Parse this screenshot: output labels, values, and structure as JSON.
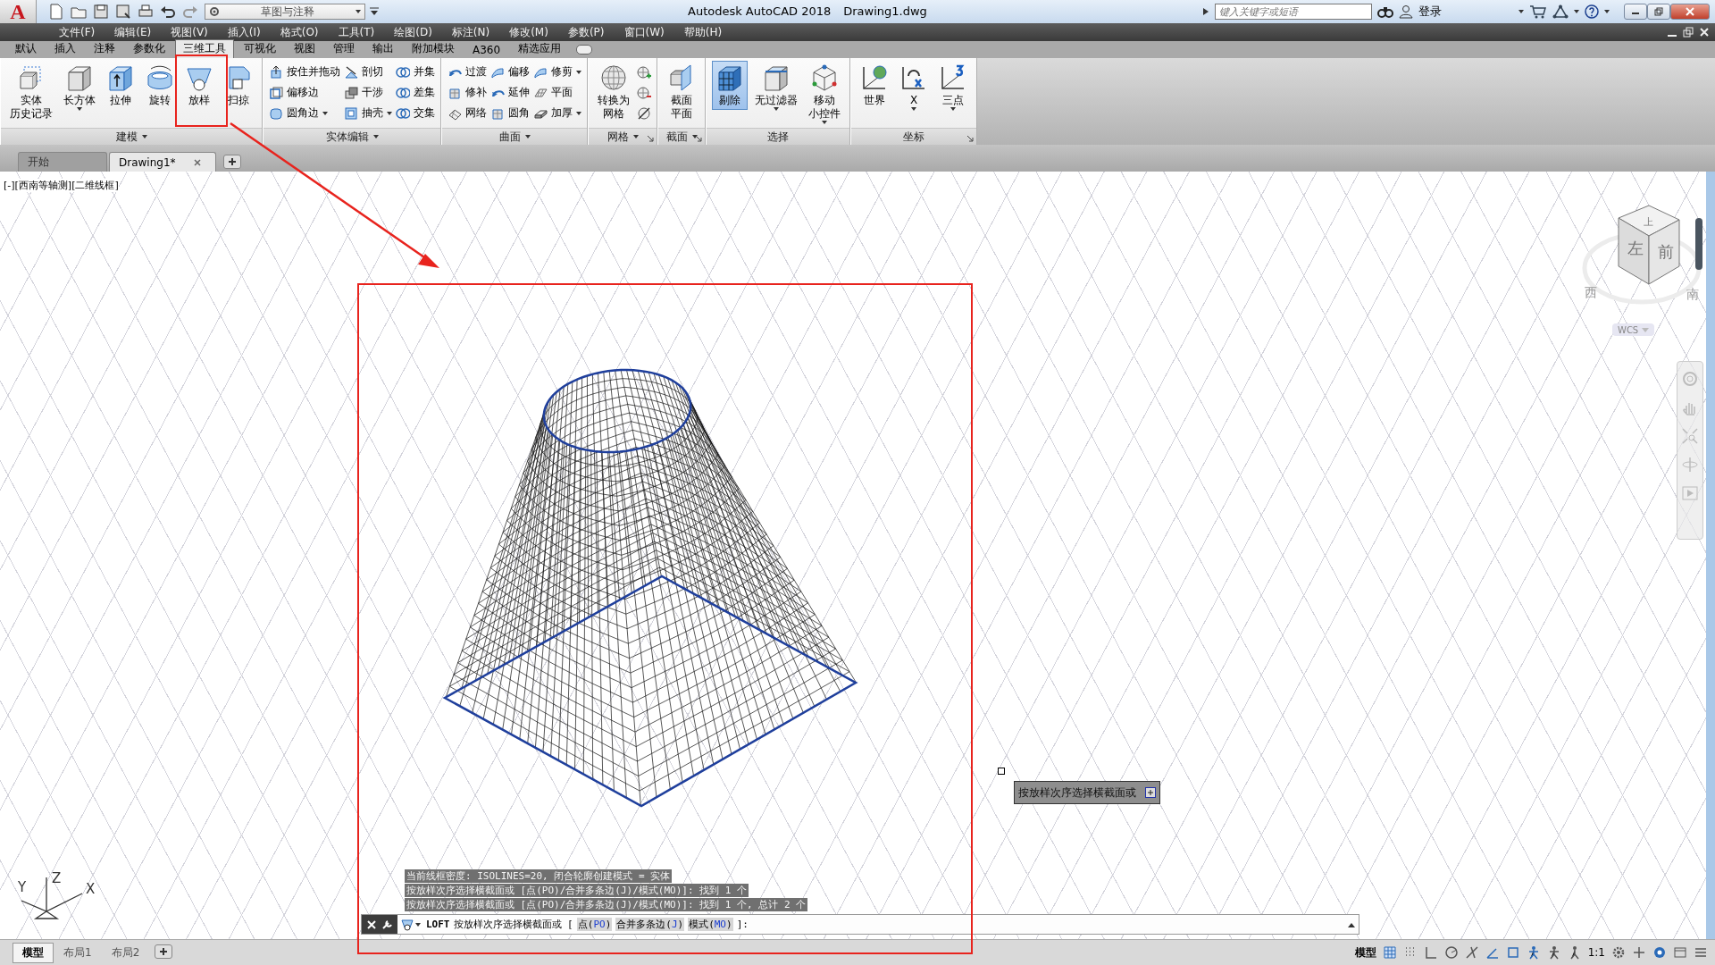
{
  "title_bar": {
    "logo": "A",
    "workspace": "草图与注释",
    "app_title": "Autodesk AutoCAD 2018",
    "document": "Drawing1.dwg",
    "search": {
      "placeholder": "键入关键字或短语"
    },
    "sign_in": "登录"
  },
  "menu_bar": [
    "文件(F)",
    "编辑(E)",
    "视图(V)",
    "插入(I)",
    "格式(O)",
    "工具(T)",
    "绘图(D)",
    "标注(N)",
    "修改(M)",
    "参数(P)",
    "窗口(W)",
    "帮助(H)"
  ],
  "ribbon_tabs": [
    {
      "label": "默认",
      "selected": false
    },
    {
      "label": "插入",
      "selected": false
    },
    {
      "label": "注释",
      "selected": false
    },
    {
      "label": "参数化",
      "selected": false
    },
    {
      "label": "三维工具",
      "selected": true
    },
    {
      "label": "可视化",
      "selected": false
    },
    {
      "label": "视图",
      "selected": false
    },
    {
      "label": "管理",
      "selected": false
    },
    {
      "label": "输出",
      "selected": false
    },
    {
      "label": "附加模块",
      "selected": false
    },
    {
      "label": "A360",
      "selected": false
    },
    {
      "label": "精选应用",
      "selected": false
    }
  ],
  "ribbon_panels": [
    {
      "title": "建模",
      "title_menu": true,
      "launcher": false,
      "columns": [
        {
          "kind": "large",
          "lines": [
            "实体",
            "历史记录"
          ],
          "dropdown": false,
          "active": false
        },
        {
          "kind": "large",
          "lines": [
            "长方体"
          ],
          "dropdown": true,
          "active": false
        },
        {
          "kind": "large",
          "lines": [
            "拉伸"
          ],
          "dropdown": false,
          "active": false
        },
        {
          "kind": "large",
          "lines": [
            "旋转"
          ],
          "dropdown": false,
          "active": false
        },
        {
          "kind": "large",
          "lines": [
            "放样"
          ],
          "dropdown": false,
          "active": false
        },
        {
          "kind": "large",
          "lines": [
            "扫掠"
          ],
          "dropdown": false,
          "active": false
        }
      ]
    },
    {
      "title": "实体编辑",
      "title_menu": true,
      "launcher": false,
      "columns": [
        {
          "kind": "stack",
          "items": [
            {
              "label": "按住并拖动",
              "dropdown": false
            },
            {
              "label": "偏移边",
              "dropdown": false
            },
            {
              "label": "圆角边",
              "dropdown": true
            }
          ]
        },
        {
          "kind": "stack",
          "items": [
            {
              "label": "剖切",
              "dropdown": false
            },
            {
              "label": "干涉",
              "dropdown": false
            },
            {
              "label": "抽壳",
              "dropdown": true
            }
          ]
        },
        {
          "kind": "stack",
          "items": [
            {
              "label": "并集",
              "dropdown": false
            },
            {
              "label": "差集",
              "dropdown": false
            },
            {
              "label": "交集",
              "dropdown": false
            }
          ]
        }
      ]
    },
    {
      "title": "曲面",
      "title_menu": true,
      "launcher": false,
      "columns": [
        {
          "kind": "stack",
          "items": [
            {
              "label": "过渡",
              "dropdown": false
            },
            {
              "label": "修补",
              "dropdown": false
            },
            {
              "label": "网络",
              "dropdown": false
            }
          ]
        },
        {
          "kind": "stack",
          "items": [
            {
              "label": "偏移",
              "dropdown": false
            },
            {
              "label": "延伸",
              "dropdown": false
            },
            {
              "label": "圆角",
              "dropdown": false
            }
          ]
        },
        {
          "kind": "stack",
          "items": [
            {
              "label": "修剪",
              "dropdown": true
            },
            {
              "label": "平面",
              "dropdown": false
            },
            {
              "label": "加厚",
              "dropdown": true
            }
          ]
        }
      ]
    },
    {
      "title": "网格",
      "title_menu": true,
      "launcher": true,
      "columns": [
        {
          "kind": "large",
          "lines": [
            "转换为",
            "网格"
          ],
          "dropdown": false,
          "active": false
        },
        {
          "kind": "stack",
          "items": [
            {
              "dropdown": false
            },
            {
              "dropdown": false
            },
            {
              "dropdown": false
            }
          ]
        }
      ]
    },
    {
      "title": "截面",
      "title_menu": true,
      "launcher": true,
      "columns": [
        {
          "kind": "large",
          "lines": [
            "截面",
            "平面"
          ],
          "dropdown": false,
          "active": false
        }
      ]
    },
    {
      "title": "选择",
      "title_menu": false,
      "launcher": false,
      "columns": [
        {
          "kind": "large",
          "lines": [
            "剔除"
          ],
          "dropdown": false,
          "active": true
        },
        {
          "kind": "large",
          "lines": [
            "无过滤器"
          ],
          "dropdown": true,
          "active": false
        },
        {
          "kind": "large",
          "lines": [
            "移动",
            "小控件"
          ],
          "dropdown": true,
          "active": false
        }
      ]
    },
    {
      "title": "坐标",
      "title_menu": false,
      "launcher": true,
      "columns": [
        {
          "kind": "large",
          "lines": [
            "世界"
          ],
          "dropdown": false,
          "active": false
        },
        {
          "kind": "large",
          "lines": [
            "X"
          ],
          "dropdown": true,
          "active": false
        },
        {
          "kind": "large",
          "lines": [
            "三点"
          ],
          "dropdown": true,
          "active": false
        }
      ]
    }
  ],
  "file_tabs": [
    {
      "label": "开始",
      "selected": false,
      "closable": false
    },
    {
      "label": "Drawing1*",
      "selected": true,
      "closable": true
    }
  ],
  "viewport": {
    "label": "[-][西南等轴测][二维线框]"
  },
  "view_cube": {
    "faces": [
      "上",
      "左",
      "前"
    ],
    "compass": [
      "西",
      "南"
    ],
    "ucs_menu": "WCS"
  },
  "ucs_icon": {
    "axes": [
      "Y",
      "Z",
      "X"
    ]
  },
  "tooltip": {
    "text": "按放样次序选择横截面或"
  },
  "command_history": [
    "当前线框密度:  ISOLINES=20, 闭合轮廓创建模式 = 实体",
    "按放样次序选择横截面或 [点(PO)/合并多条边(J)/模式(MO)]: 找到 1 个",
    "按放样次序选择横截面或 [点(PO)/合并多条边(J)/模式(MO)]: 找到 1 个, 总计 2 个"
  ],
  "command_line": {
    "command": "LOFT",
    "prompt": "按放样次序选择横截面或 [",
    "options": [
      {
        "before": "点(",
        "key": "PO",
        "after": ")"
      },
      {
        "before": "合并多条边(",
        "key": "J",
        "after": ")"
      },
      {
        "before": "模式(",
        "key": "MO",
        "after": ")"
      }
    ],
    "suffix": "]:"
  },
  "layout_tabs": [
    {
      "label": "模型",
      "selected": true
    },
    {
      "label": "布局1",
      "selected": false
    },
    {
      "label": "布局2",
      "selected": false
    }
  ],
  "status_bar": {
    "space": "模型",
    "scale": "1:1"
  }
}
